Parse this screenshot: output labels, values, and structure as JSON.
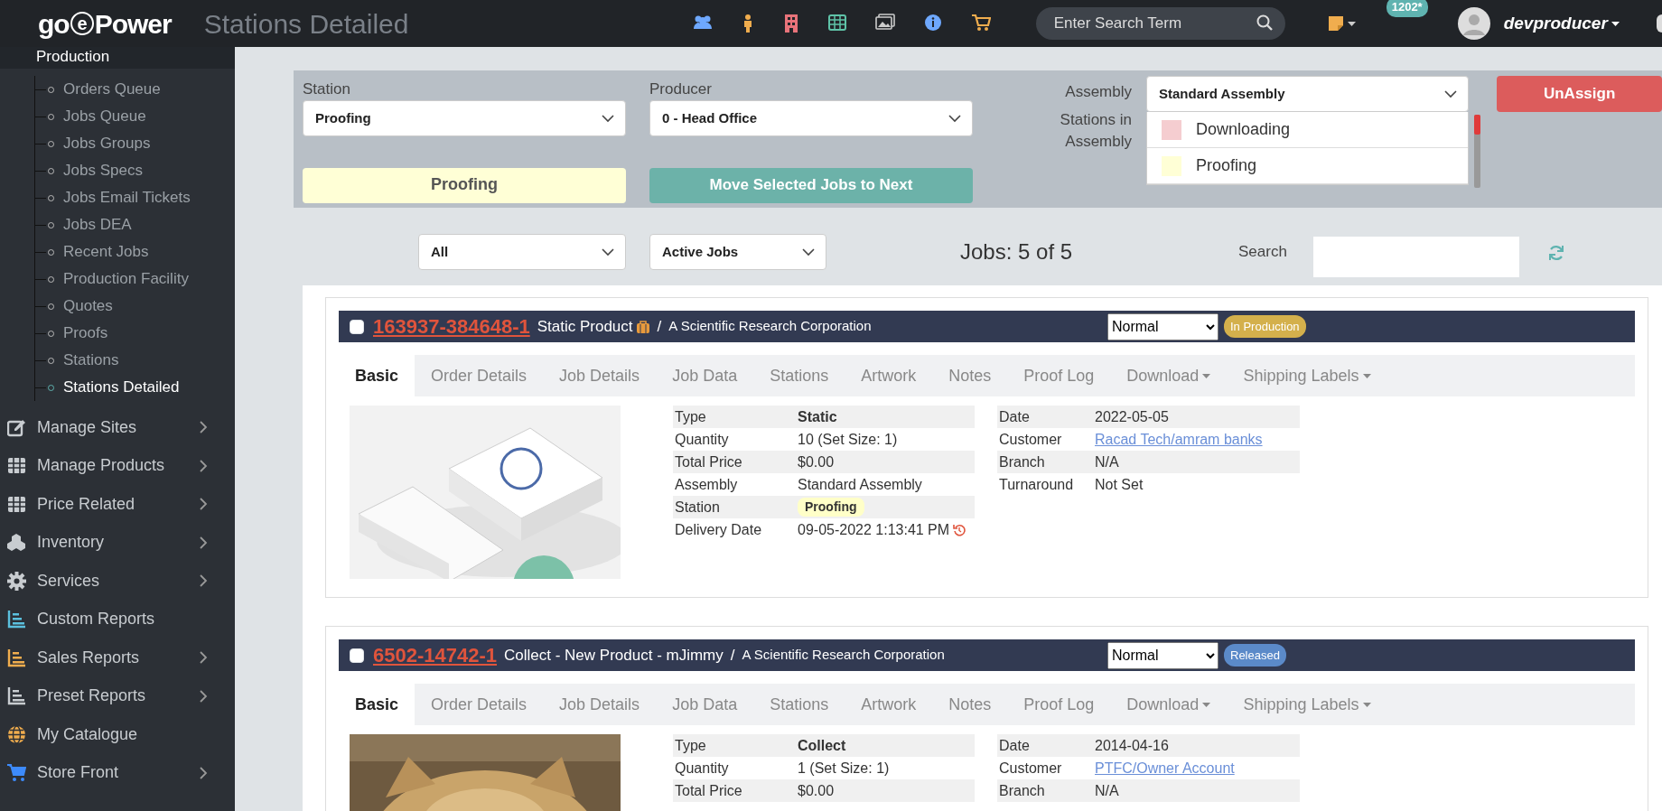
{
  "header": {
    "logo": [
      "go",
      "e",
      "Power"
    ],
    "page_title": "Stations Detailed",
    "search": {
      "placeholder": "Enter Search Term"
    },
    "notification_count": "1202*",
    "user": "devproducer"
  },
  "sidebar": {
    "section": "Production",
    "sub_items": [
      {
        "label": "Orders Queue",
        "selected": false
      },
      {
        "label": "Jobs Queue",
        "selected": false
      },
      {
        "label": "Jobs Groups",
        "selected": false
      },
      {
        "label": "Jobs Specs",
        "selected": false
      },
      {
        "label": "Jobs Email Tickets",
        "selected": false
      },
      {
        "label": "Jobs DEA",
        "selected": false
      },
      {
        "label": "Recent Jobs",
        "selected": false
      },
      {
        "label": "Production Facility",
        "selected": false
      },
      {
        "label": "Quotes",
        "selected": false
      },
      {
        "label": "Proofs",
        "selected": false
      },
      {
        "label": "Stations",
        "selected": false
      },
      {
        "label": "Stations Detailed",
        "selected": true
      }
    ],
    "items": [
      {
        "label": "Manage Sites",
        "kind": "edit",
        "color": "#c8ccd0",
        "expandable": true
      },
      {
        "label": "Manage Products",
        "kind": "grid",
        "color": "#c8ccd0",
        "expandable": true
      },
      {
        "label": "Price Related",
        "kind": "grid",
        "color": "#c8ccd0",
        "expandable": true
      },
      {
        "label": "Inventory",
        "kind": "cubes",
        "color": "#c8ccd0",
        "expandable": true
      },
      {
        "label": "Services",
        "kind": "gear",
        "color": "#c8ccd0",
        "expandable": true
      },
      {
        "label": "Custom Reports",
        "kind": "chart",
        "color": "#5bc0de",
        "expandable": false
      },
      {
        "label": "Sales Reports",
        "kind": "chart",
        "color": "#f0ad4e",
        "expandable": true
      },
      {
        "label": "Preset Reports",
        "kind": "chart",
        "color": "#c8ccd0",
        "expandable": true
      },
      {
        "label": "My Catalogue",
        "kind": "globe",
        "color": "#f0ad4e",
        "expandable": false
      },
      {
        "label": "Store Front",
        "kind": "cart",
        "color": "#3d8bfd",
        "expandable": true
      }
    ]
  },
  "filters": {
    "station": {
      "label": "Station",
      "value": "Proofing"
    },
    "producer": {
      "label": "Producer",
      "value": "0 - Head Office"
    },
    "current_station": "Proofing",
    "move_button": "Move Selected Jobs to Next",
    "assembly": {
      "label": "Assembly",
      "value": "Standard Assembly"
    },
    "stations_label": "Stations in Assembly",
    "stations": [
      {
        "name": "Downloading",
        "color": "#f5cdd0"
      },
      {
        "name": "Proofing",
        "color": "#ffffd6"
      }
    ],
    "unassign_button": "UnAssign"
  },
  "list_controls": {
    "type_filter": "All",
    "status_filter": "Active Jobs",
    "count": "Jobs: 5 of 5",
    "search_label": "Search"
  },
  "jobs": [
    {
      "checked": false,
      "id": "163937-384648-1",
      "product": "Static Product",
      "has_product_icon": true,
      "separator": "/",
      "company": "A Scientific Research Corporation",
      "priority": "Normal",
      "status": {
        "label": "In Production",
        "color": "#d4b04c"
      },
      "tabs": [
        {
          "label": "Basic",
          "selected": true,
          "dropdown": false
        },
        {
          "label": "Order Details",
          "selected": false,
          "dropdown": false
        },
        {
          "label": "Job Details",
          "selected": false,
          "dropdown": false
        },
        {
          "label": "Job Data",
          "selected": false,
          "dropdown": false
        },
        {
          "label": "Stations",
          "selected": false,
          "dropdown": false
        },
        {
          "label": "Artwork",
          "selected": false,
          "dropdown": false
        },
        {
          "label": "Notes",
          "selected": false,
          "dropdown": false
        },
        {
          "label": "Proof Log",
          "selected": false,
          "dropdown": false
        },
        {
          "label": "Download",
          "selected": false,
          "dropdown": true
        },
        {
          "label": "Shipping Labels",
          "selected": false,
          "dropdown": true
        }
      ],
      "details_left": [
        {
          "label": "Type",
          "value": "Static",
          "kind": "bold"
        },
        {
          "label": "Quantity",
          "value": "10 (Set Size: 1)",
          "kind": "text"
        },
        {
          "label": "Total Price",
          "value": "$0.00",
          "kind": "text"
        },
        {
          "label": "Assembly",
          "value": "Standard Assembly",
          "kind": "text"
        },
        {
          "label": "Station",
          "value": "Proofing",
          "kind": "badge"
        },
        {
          "label": "Delivery Date",
          "value": "09-05-2022 1:13:41 PM",
          "kind": "history"
        }
      ],
      "details_right": [
        {
          "label": "Date",
          "value": "2022-05-05",
          "kind": "text"
        },
        {
          "label": "Customer",
          "value": "Racad Tech/amram banks",
          "kind": "link"
        },
        {
          "label": "Branch",
          "value": "N/A",
          "kind": "text"
        },
        {
          "label": "Turnaround",
          "value": "Not Set",
          "kind": "text"
        }
      ]
    },
    {
      "checked": false,
      "id": "6502-14742-1",
      "product": "Collect - New Product - mJimmy",
      "has_product_icon": false,
      "separator": "/",
      "company": "A Scientific Research Corporation",
      "priority": "Normal",
      "status": {
        "label": "Released",
        "color": "#5b8ac9"
      },
      "tabs": [
        {
          "label": "Basic",
          "selected": true,
          "dropdown": false
        },
        {
          "label": "Order Details",
          "selected": false,
          "dropdown": false
        },
        {
          "label": "Job Details",
          "selected": false,
          "dropdown": false
        },
        {
          "label": "Job Data",
          "selected": false,
          "dropdown": false
        },
        {
          "label": "Stations",
          "selected": false,
          "dropdown": false
        },
        {
          "label": "Artwork",
          "selected": false,
          "dropdown": false
        },
        {
          "label": "Notes",
          "selected": false,
          "dropdown": false
        },
        {
          "label": "Proof Log",
          "selected": false,
          "dropdown": false
        },
        {
          "label": "Download",
          "selected": false,
          "dropdown": true
        },
        {
          "label": "Shipping Labels",
          "selected": false,
          "dropdown": true
        }
      ],
      "details_left": [
        {
          "label": "Type",
          "value": "Collect",
          "kind": "bold"
        },
        {
          "label": "Quantity",
          "value": "1 (Set Size: 1)",
          "kind": "text"
        },
        {
          "label": "Total Price",
          "value": "$0.00",
          "kind": "text"
        }
      ],
      "details_right": [
        {
          "label": "Date",
          "value": "2014-04-16",
          "kind": "text"
        },
        {
          "label": "Customer",
          "value": "PTFC/Owner Account",
          "kind": "link"
        },
        {
          "label": "Branch",
          "value": "N/A",
          "kind": "text"
        }
      ]
    }
  ]
}
